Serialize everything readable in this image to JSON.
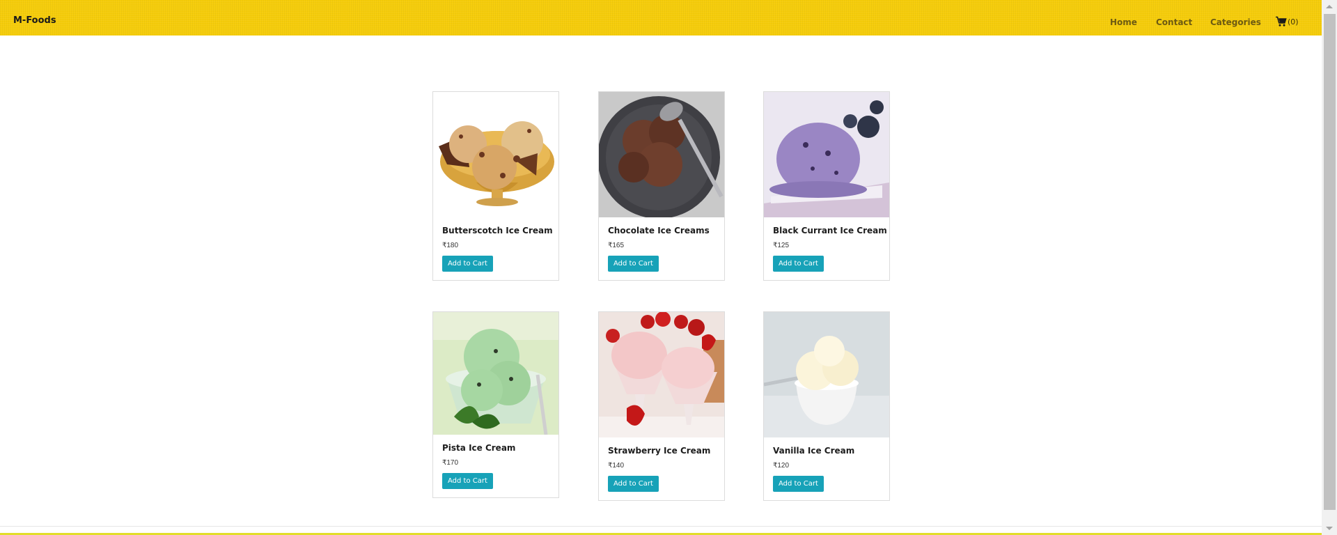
{
  "navbar": {
    "brand": "M-Foods",
    "links": [
      "Home",
      "Contact",
      "Categories"
    ],
    "cart_count": "(0)",
    "background_color": "#f5cc0a"
  },
  "products": [
    {
      "name": "Butterscotch Ice Cream",
      "price": "₹180",
      "button": "Add to Cart"
    },
    {
      "name": "Chocolate Ice Creams",
      "price": "₹165",
      "button": "Add to Cart"
    },
    {
      "name": "Black Currant Ice Cream",
      "price": "₹125",
      "button": "Add to Cart"
    },
    {
      "name": "Pista Ice Cream",
      "price": "₹170",
      "button": "Add to Cart"
    },
    {
      "name": "Strawberry Ice Cream",
      "price": "₹140",
      "button": "Add to Cart"
    },
    {
      "name": "Vanilla Ice Cream",
      "price": "₹120",
      "button": "Add to Cart"
    }
  ],
  "accent_color": "#17a2b8"
}
